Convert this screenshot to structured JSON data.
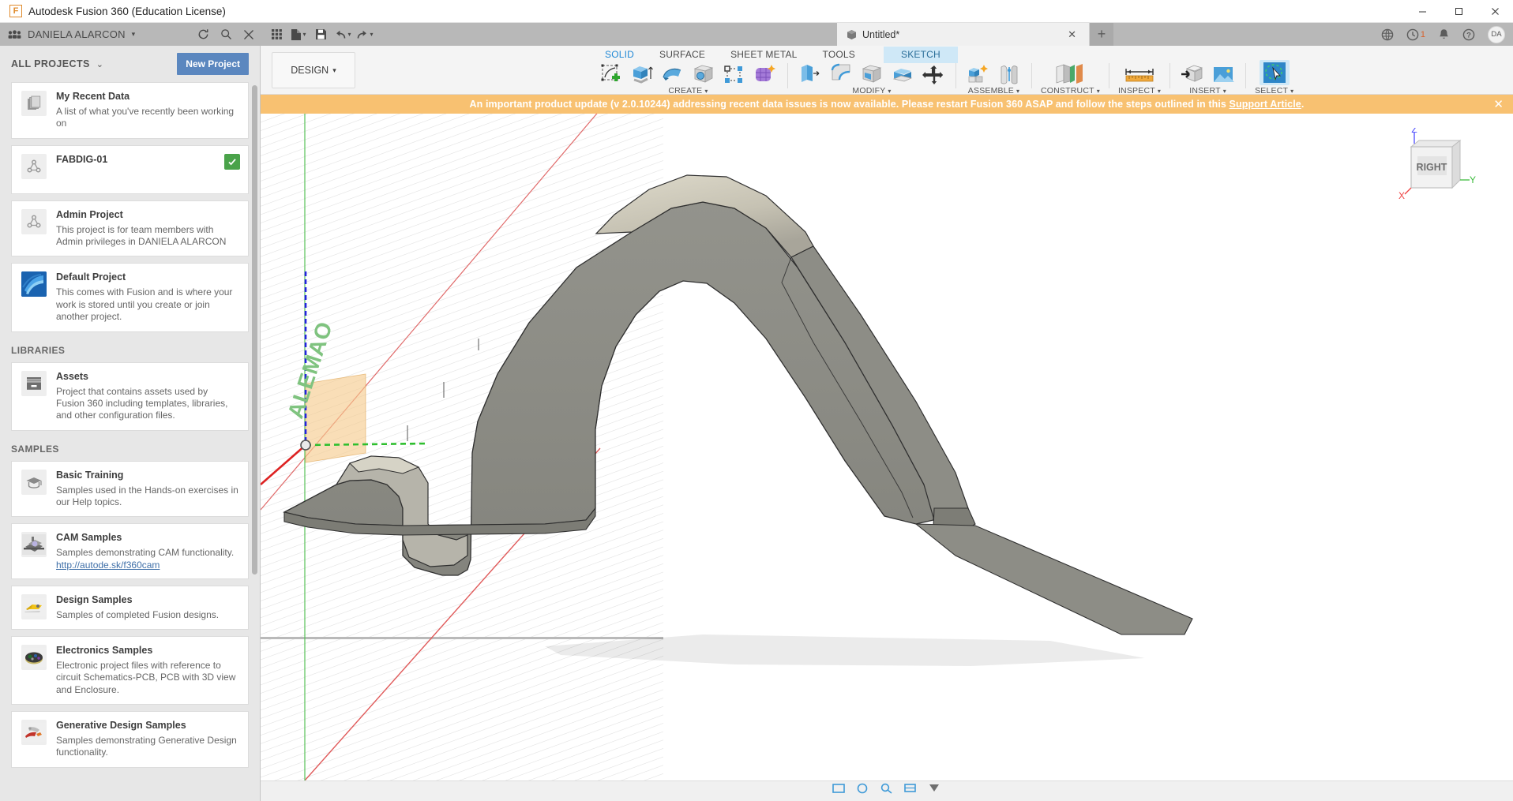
{
  "window": {
    "title": "Autodesk Fusion 360 (Education License)",
    "minimize": "–",
    "maximize": "□",
    "close": "✕"
  },
  "appbar": {
    "hub_name": "DANIELA ALARCON",
    "hub_caret": "▾",
    "refresh_icon": "refresh-icon",
    "search_icon": "search-icon",
    "close_panel_icon": "close-icon",
    "grid_icon": "grid-icon",
    "new_file_icon": "new-file-icon",
    "save_icon": "save-icon",
    "undo_icon": "undo-icon",
    "redo_icon": "redo-icon",
    "caret": "▾",
    "doc_tab_name": "Untitled*",
    "doc_tab_close": "✕",
    "new_tab": "+",
    "notifications_count": "1",
    "avatar_initials": "DA"
  },
  "datapanel": {
    "header": "ALL PROJECTS",
    "header_caret": "⌄",
    "new_project_label": "New Project",
    "projects": [
      {
        "title": "My Recent Data",
        "desc": "A list of what you've recently been working on",
        "icon": "documents-icon",
        "badge": null
      },
      {
        "title": "FABDIG-01",
        "desc": "",
        "icon": "project-network-icon",
        "badge": "shared-badge"
      },
      {
        "title": "Admin Project",
        "desc": "This project is for team members with Admin privileges in DANIELA ALARCON",
        "icon": "project-network-icon",
        "badge": null
      },
      {
        "title": "Default Project",
        "desc": "This comes with Fusion and is where your work is stored until you create or join another project.",
        "icon": "fusion-swirl-icon",
        "badge": null
      }
    ],
    "libraries_label": "LIBRARIES",
    "libraries": [
      {
        "title": "Assets",
        "desc": "Project that contains assets used by Fusion 360 including templates, libraries, and other configuration files.",
        "icon": "archive-box-icon"
      }
    ],
    "samples_label": "SAMPLES",
    "samples": [
      {
        "title": "Basic Training",
        "desc": "Samples used in the Hands-on exercises in our Help topics.",
        "link": "",
        "icon": "graduation-cap-icon"
      },
      {
        "title": "CAM Samples",
        "desc": "Samples demonstrating CAM functionality.",
        "link": "http://autode.sk/f360cam",
        "icon": "cam-machine-icon"
      },
      {
        "title": "Design Samples",
        "desc": "Samples of completed Fusion designs.",
        "link": "",
        "icon": "design-part-icon"
      },
      {
        "title": "Electronics Samples",
        "desc": "Electronic project files with reference to circuit Schematics-PCB, PCB with 3D view and Enclosure.",
        "link": "",
        "icon": "pcb-icon"
      },
      {
        "title": "Generative Design Samples",
        "desc": "Samples demonstrating Generative Design functionality.",
        "link": "",
        "icon": "generative-part-icon"
      }
    ]
  },
  "ribbon": {
    "workspace_label": "DESIGN",
    "workspace_caret": "▾",
    "tabs": [
      {
        "label": "SOLID",
        "state": "active"
      },
      {
        "label": "SURFACE",
        "state": "normal"
      },
      {
        "label": "SHEET METAL",
        "state": "normal"
      },
      {
        "label": "TOOLS",
        "state": "normal"
      },
      {
        "label": "SKETCH",
        "state": "sketchmode"
      }
    ],
    "panels": [
      {
        "title": "CREATE",
        "caret": "▾",
        "tools": [
          "create-sketch-icon",
          "extrude-icon",
          "revolve-icon",
          "hole-icon",
          "pattern-icon",
          "form-icon"
        ]
      },
      {
        "title": "MODIFY",
        "caret": "▾",
        "tools": [
          "press-pull-icon",
          "fillet-icon",
          "shell-icon",
          "combine-icon",
          "align-icon",
          "move-copy-icon"
        ]
      },
      {
        "title": "ASSEMBLE",
        "caret": "▾",
        "tools": [
          "new-component-icon",
          "joint-icon"
        ]
      },
      {
        "title": "CONSTRUCT",
        "caret": "▾",
        "tools": [
          "offset-plane-icon"
        ]
      },
      {
        "title": "INSPECT",
        "caret": "▾",
        "tools": [
          "measure-icon"
        ]
      },
      {
        "title": "INSERT",
        "caret": "▾",
        "tools": [
          "insert-derive-icon",
          "insert-image-icon"
        ]
      },
      {
        "title": "SELECT",
        "caret": "▾",
        "tools": [
          "select-lasso-icon"
        ]
      }
    ]
  },
  "banner": {
    "text_before": "An important product update (v 2.0.10244) addressing recent data issues is now available. Please restart Fusion 360 ASAP and follow the steps outlined in this ",
    "link": "Support Article",
    "text_after": ".",
    "close": "✕",
    "color": "#f8c171"
  },
  "viewcube": {
    "face_label": "RIGHT",
    "axis_z": "Z",
    "axis_y": "Y",
    "axis_x": "X",
    "color_z": "#4a4aff",
    "color_y": "#3dbb3d",
    "color_x": "#ef4444"
  },
  "canvas": {
    "sketch_text": "ALEMAO",
    "sketch_text_color": "#7fc37f",
    "model_fill": "#8b8b85",
    "model_top_fill": "#cfcbbc",
    "plane_fill": "#f5c98a",
    "origin_label": "origin-point"
  },
  "navbar": {
    "icons": [
      "orbit-icon",
      "pan-icon",
      "zoom-icon",
      "display-settings-icon",
      "grid-snap-icon"
    ]
  }
}
